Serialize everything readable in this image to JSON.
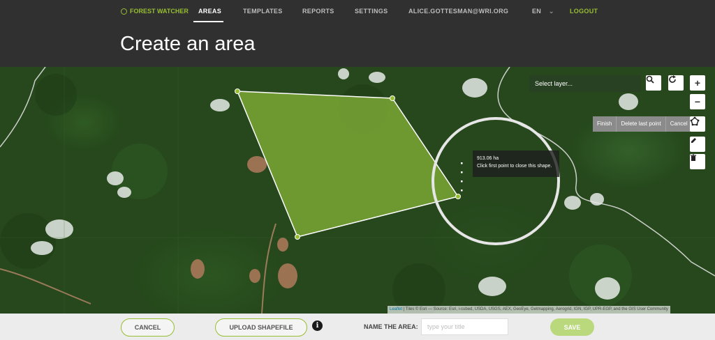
{
  "nav": {
    "brand": "FOREST WATCHER",
    "items": [
      "AREAS",
      "TEMPLATES",
      "REPORTS",
      "SETTINGS",
      "ALICE.GOTTESMAN@WRI.ORG"
    ],
    "language": "EN",
    "logout": "LOGOUT"
  },
  "page": {
    "title": "Create an area"
  },
  "map": {
    "layer_select": "Select layer...",
    "zoom_in": "+",
    "zoom_out": "−",
    "draw_actions": [
      "Finish",
      "Delete last point",
      "Cancel"
    ],
    "tooltip": {
      "area": "913.06 ha",
      "hint": "Click first point to close this shape."
    },
    "attribution_link": "Leaflet",
    "attribution_text": "| Tiles © Esri — Source: Esri, i-cubed, USDA, USGS, AEX, GeoEye, Getmapping, Aerogrid, IGN, IGP, UPR-EGP, and the GIS User Community"
  },
  "footer": {
    "cancel": "CANCEL",
    "upload": "UPLOAD SHAPEFILE",
    "info": "i",
    "name_label": "NAME THE AREA:",
    "name_placeholder": "type your title",
    "save": "SAVE"
  },
  "colors": {
    "accent": "#97be32",
    "polygon_fill": "#8bb83a",
    "nav_bg": "#303030"
  }
}
